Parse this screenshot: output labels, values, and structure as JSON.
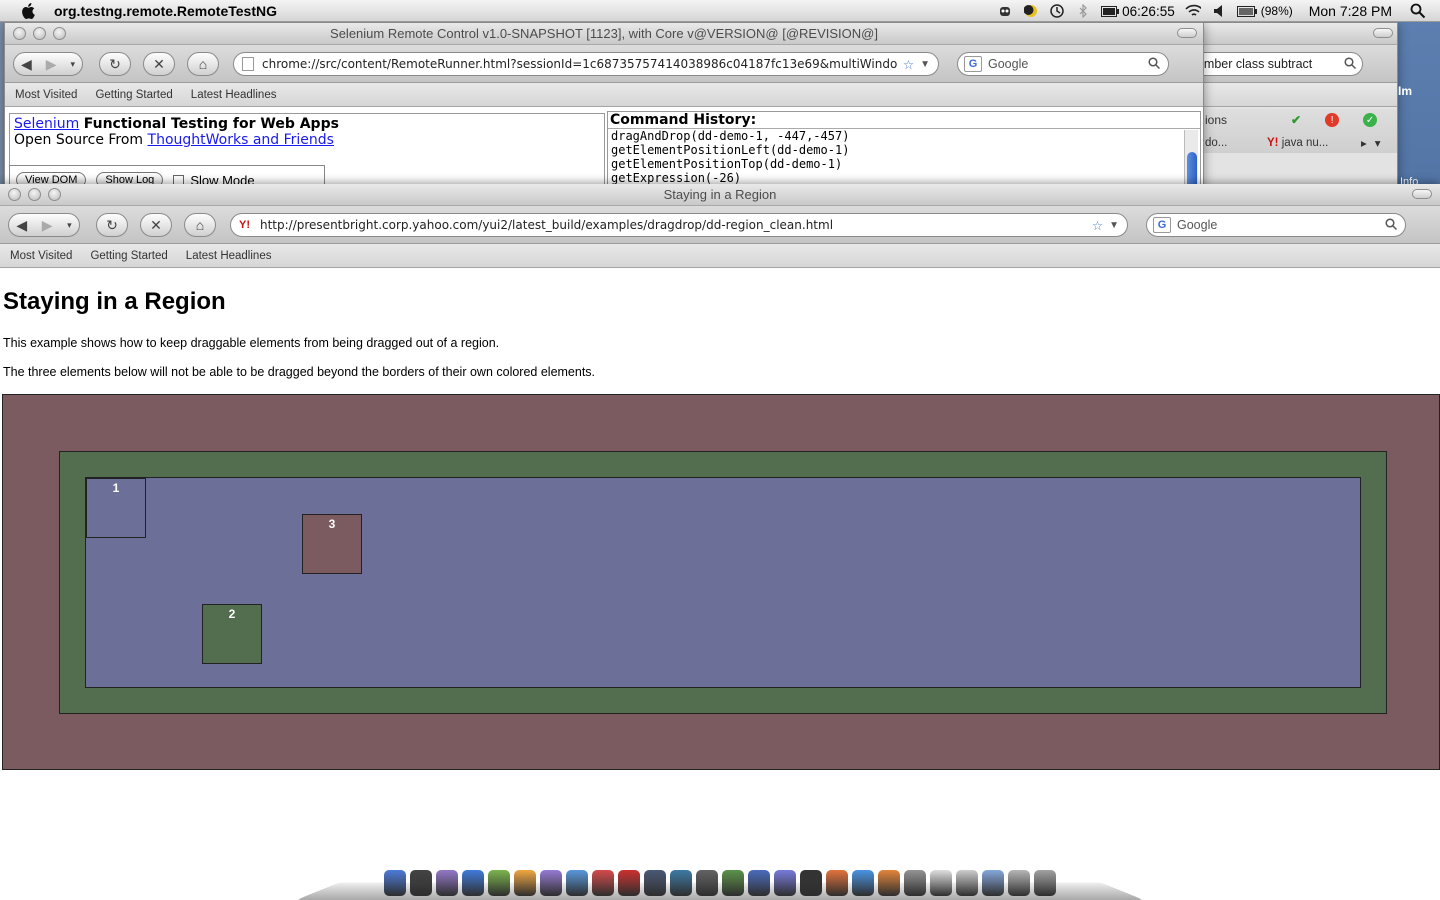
{
  "menubar": {
    "app_name": "org.testng.remote.RemoteTestNG",
    "clock_time": "06:26:55",
    "battery": "(98%)",
    "datetime": "Mon 7:28 PM"
  },
  "selenium_window": {
    "title": "Selenium Remote Control v1.0-SNAPSHOT [1123], with Core v@VERSION@ [@REVISION@]",
    "url": "chrome://src/content/RemoteRunner.html?sessionId=1c68735757414038986c04187fc13e69&multiWindow",
    "search_placeholder": "Google",
    "bookmarks": [
      "Most Visited",
      "Getting Started",
      "Latest Headlines"
    ],
    "brand_link": "Selenium",
    "brand_tagline": "Functional Testing for Web Apps",
    "open_source_prefix": "Open Source From",
    "open_source_link": "ThoughtWorks and Friends",
    "view_dom": "View DOM",
    "show_log": "Show Log",
    "slow_mode": "Slow Mode",
    "command_history_title": "Command History:",
    "commands": [
      "dragAndDrop(dd-demo-1, -447,-457)",
      "getElementPositionLeft(dd-demo-1)",
      "getElementPositionTop(dd-demo-1)",
      "getExpression(-26)"
    ]
  },
  "behind_window": {
    "search_text": "number class subtract",
    "options_label": "ions",
    "tab1": "do...",
    "tab2": "java nu...",
    "info_label": "Info",
    "im_label": "Im"
  },
  "yahoo_window": {
    "title": "Staying in a Region",
    "url": "http://presentbright.corp.yahoo.com/yui2/latest_build/examples/dragdrop/dd-region_clean.html",
    "search_placeholder": "Google",
    "bookmarks": [
      "Most Visited",
      "Getting Started",
      "Latest Headlines"
    ]
  },
  "page": {
    "heading": "Staying in a Region",
    "para1": "This example shows how to keep draggable elements from being dragged out of a region.",
    "para2": "The three elements below will not be able to be dragged beyond the borders of their own colored elements.",
    "dd1_label": "1",
    "dd2_label": "2",
    "dd3_label": "3"
  },
  "colors": {
    "region_outer": "#7b5b60",
    "region_mid": "#536d4f",
    "region_inner": "#6c7099",
    "link": "#1a1aee"
  },
  "dock": {
    "apps": [
      "finder-icon",
      "dashboard-icon",
      "preview-icon",
      "word-icon",
      "iweb-icon",
      "pages-icon",
      "keynote-icon",
      "iphoto-icon",
      "ichat-icon",
      "pdf-icon",
      "expose-icon",
      "cisco-icon",
      "utility-icon",
      "automator-icon",
      "network-icon",
      "eclipse-icon",
      "terminal-icon",
      "firefox-icon",
      "safari-icon",
      "firefox-alt-icon",
      "script-icon",
      "docs-icon",
      "stack-icon",
      "folder-icon",
      "downloads-icon",
      "trash-icon"
    ]
  }
}
